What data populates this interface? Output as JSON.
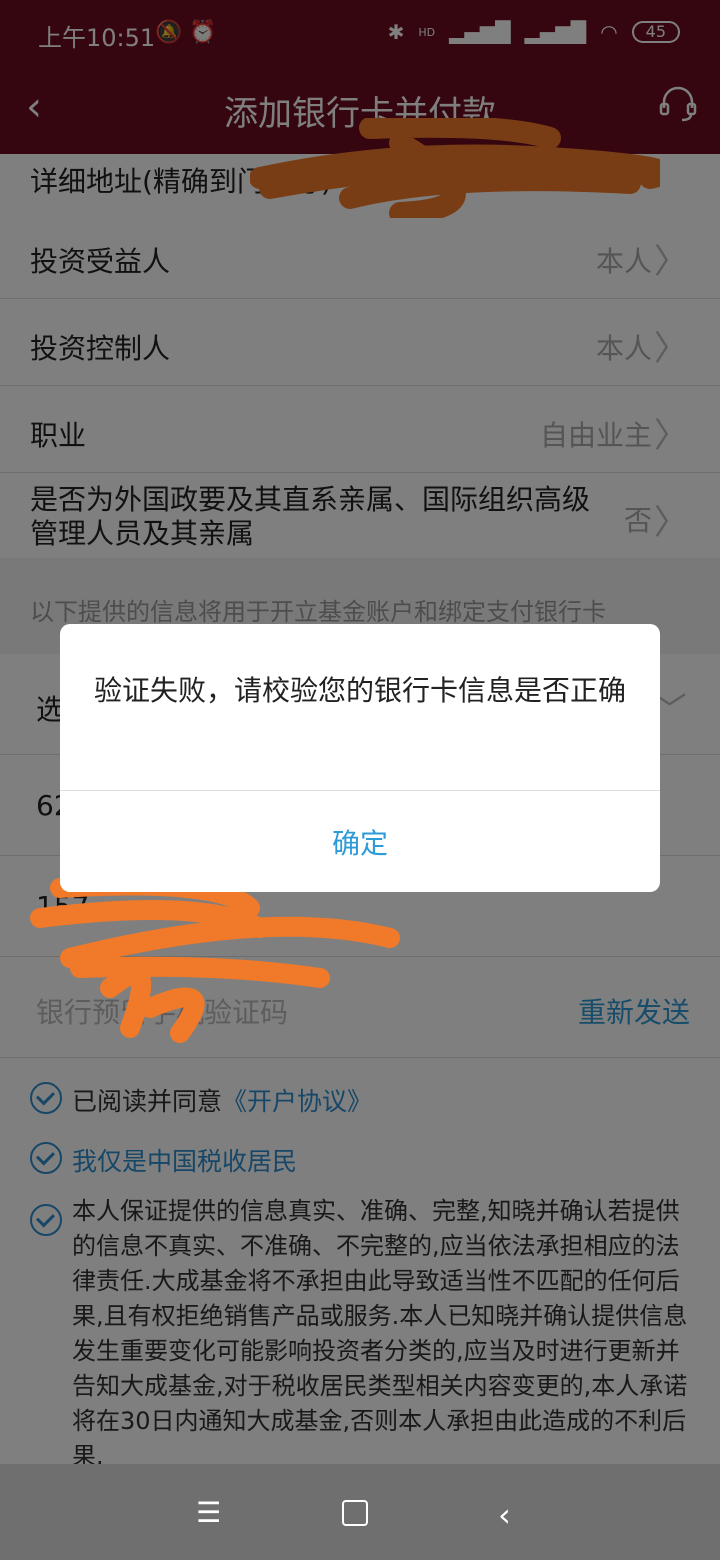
{
  "status_bar": {
    "time": "上午10:51",
    "battery": "45",
    "hd_label": "HD"
  },
  "header": {
    "title": "添加银行卡并付款"
  },
  "form": {
    "address_label": "详细地址(精确到门牌号)",
    "rows": [
      {
        "label": "投资受益人",
        "value": "本人"
      },
      {
        "label": "投资控制人",
        "value": "本人"
      },
      {
        "label": "职业",
        "value": "自由业主"
      },
      {
        "label": "是否为外国政要及其直系亲属、国际组织高级管理人员及其亲属",
        "value": "否"
      }
    ],
    "note": "以下提供的信息将用于开立基金账户和绑定支付银行卡",
    "bank_select_partial": "选",
    "card_number_partial": "62",
    "phone_partial": "157",
    "sms_placeholder": "银行预留手机验证码",
    "resend": "重新发送"
  },
  "agreements": {
    "agree_prefix": "已阅读并同意",
    "agreement_link": "《开户协议》",
    "tax_resident": "我仅是中国税收居民",
    "declaration": "本人保证提供的信息真实、准确、完整,知晓并确认若提供的信息不真实、不准确、不完整的,应当依法承担相应的法律责任.大成基金将不承担由此导致适当性不匹配的任何后果,且有权拒绝销售产品或服务.本人已知晓并确认提供信息发生重要变化可能影响投资者分类的,应当及时进行更新并告知大成基金,对于税收居民类型相关内容变更的,本人承诺将在30日内通知大成基金,否则本人承担由此造成的不利后果."
  },
  "dialog": {
    "message": "验证失败，请校验您的银行卡信息是否正确",
    "confirm": "确定"
  },
  "colors": {
    "header_bg": "#6a0d1f",
    "accent": "#2e9bd6",
    "scribble": "#f07a2a"
  }
}
